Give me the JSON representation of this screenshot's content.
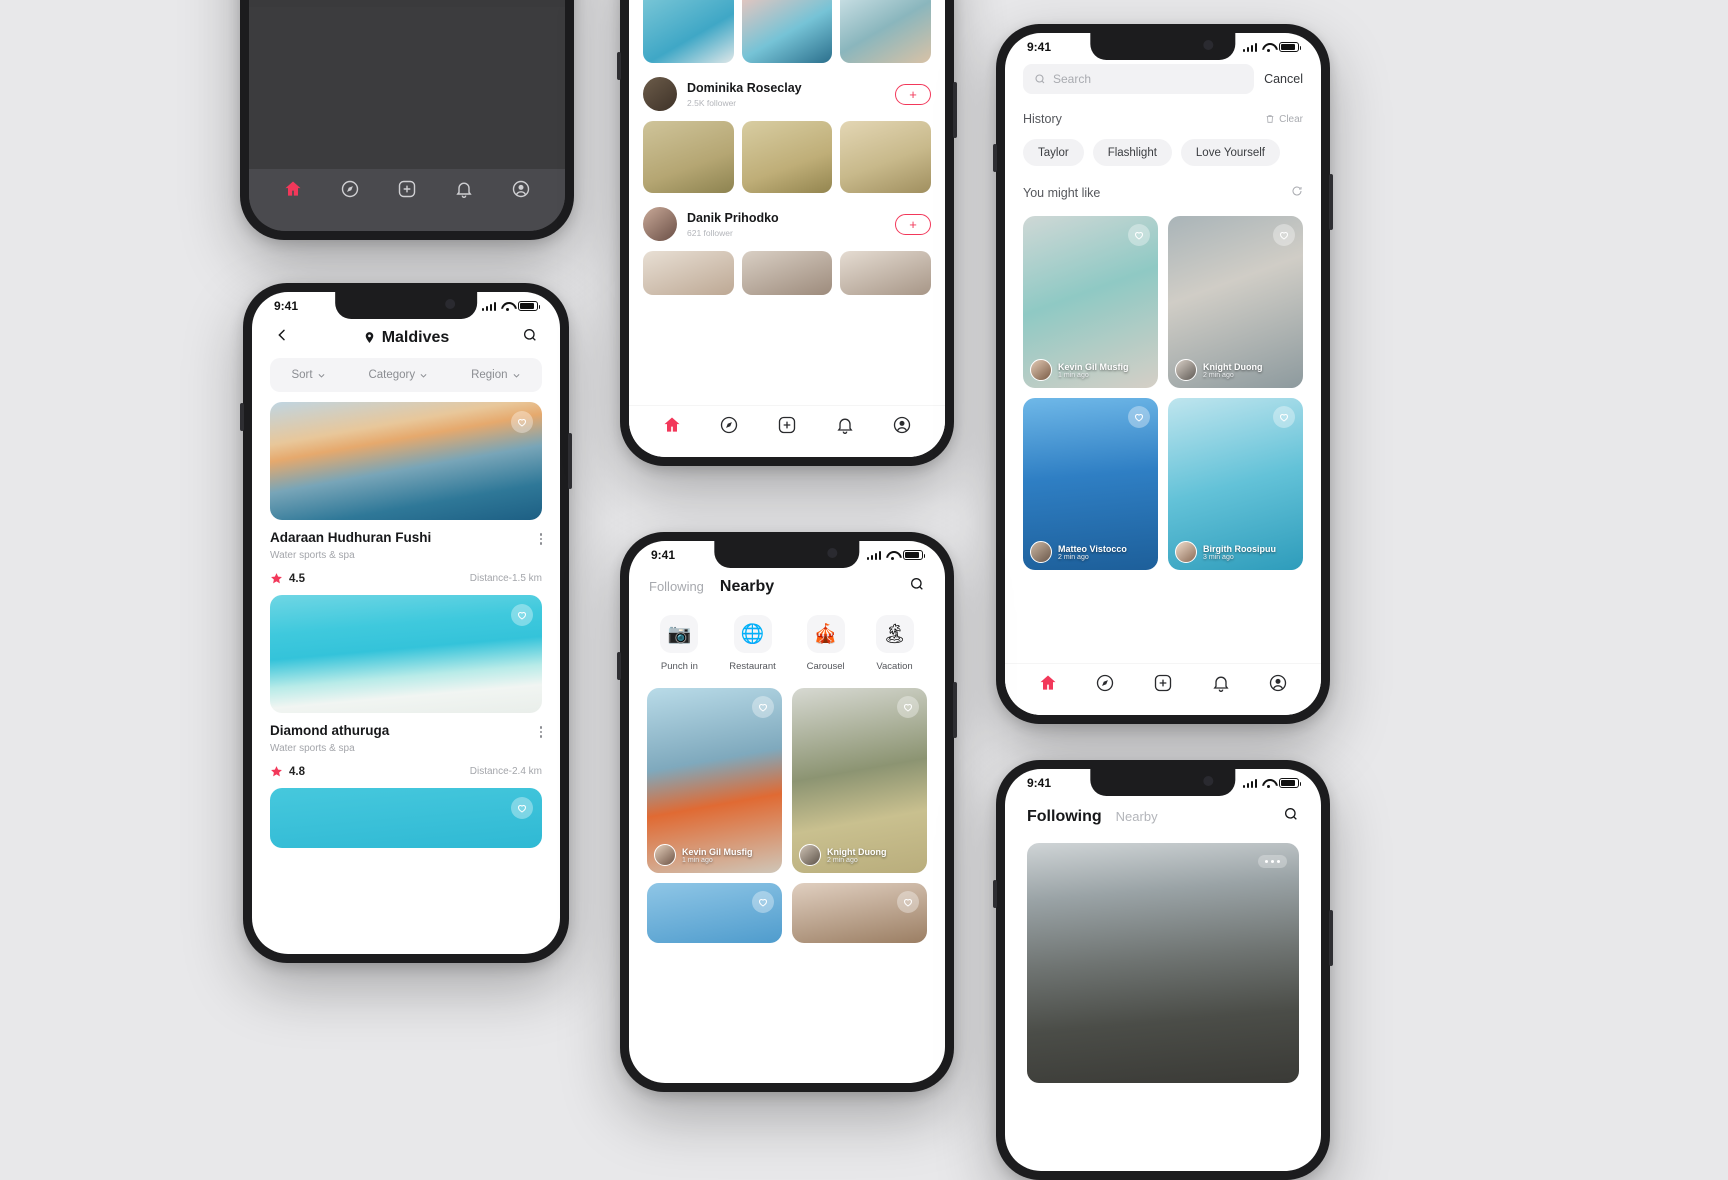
{
  "status_bar": {
    "time": "9:41"
  },
  "phone_topleft": {
    "name": "profile-grid-screen",
    "tabs": [
      "home-icon",
      "compass-icon",
      "plus-square-icon",
      "bell-icon",
      "avatar-icon"
    ]
  },
  "phone_maldives": {
    "title": "Maldives",
    "back_icon": "chevron-left-icon",
    "search_icon": "search-icon",
    "pin_icon": "location-pin-icon",
    "filters": [
      {
        "label": "Sort"
      },
      {
        "label": "Category"
      },
      {
        "label": "Region"
      }
    ],
    "listings": [
      {
        "name": "Adaraan Hudhuran Fushi",
        "subtitle": "Water sports & spa",
        "rating": "4.5",
        "distance": "Distance-1.5 km"
      },
      {
        "name": "Diamond athuruga",
        "subtitle": "Water sports & spa",
        "rating": "4.8",
        "distance": "Distance-2.4 km"
      }
    ]
  },
  "phone_feed": {
    "users": [
      {
        "name": "Dominika Roseclay",
        "followers": "2.5K follower",
        "follow_label": "+"
      },
      {
        "name": "Danik Prihodko",
        "followers": "621 follower",
        "follow_label": "+"
      }
    ],
    "tabs": [
      "home-icon",
      "compass-icon",
      "plus-square-icon",
      "bell-icon",
      "avatar-icon"
    ]
  },
  "phone_search": {
    "search_placeholder": "Search",
    "search_icon": "search-icon",
    "cancel_label": "Cancel",
    "history_label": "History",
    "clear_label": "Clear",
    "clear_icon": "trash-icon",
    "chips": [
      "Taylor",
      "Flashlight",
      "Love Yourself"
    ],
    "suggest_label": "You might like",
    "refresh_icon": "refresh-icon",
    "cards": [
      {
        "user": "Kevin Gil Musfig",
        "time": "1 min ago"
      },
      {
        "user": "Knight Duong",
        "time": "2 min ago"
      },
      {
        "user": "Matteo Vistocco",
        "time": "2 min ago"
      },
      {
        "user": "Birgith Roosipuu",
        "time": "3 min ago"
      }
    ],
    "tabs": [
      "home-icon",
      "compass-icon",
      "plus-square-icon",
      "bell-icon",
      "avatar-icon"
    ]
  },
  "phone_nearby": {
    "tab_inactive": "Following",
    "tab_active": "Nearby",
    "search_icon": "search-icon",
    "categories": [
      {
        "label": "Punch in",
        "icon": "camera-icon"
      },
      {
        "label": "Restaurant",
        "icon": "globe-icon"
      },
      {
        "label": "Carousel",
        "icon": "carousel-icon"
      },
      {
        "label": "Vacation",
        "icon": "palm-tree-icon"
      }
    ],
    "cards": [
      {
        "user": "Kevin Gil Musfig",
        "time": "1 min ago"
      },
      {
        "user": "Knight Duong",
        "time": "2 min ago"
      }
    ]
  },
  "phone_botright": {
    "tab_active": "Following",
    "tab_inactive": "Nearby",
    "search_icon": "search-icon",
    "more_icon": "more-dots-icon"
  },
  "colors": {
    "accent": "#f2385a",
    "background": "#e8e8ea",
    "text": "#17181a",
    "muted": "#a3a5aa"
  }
}
